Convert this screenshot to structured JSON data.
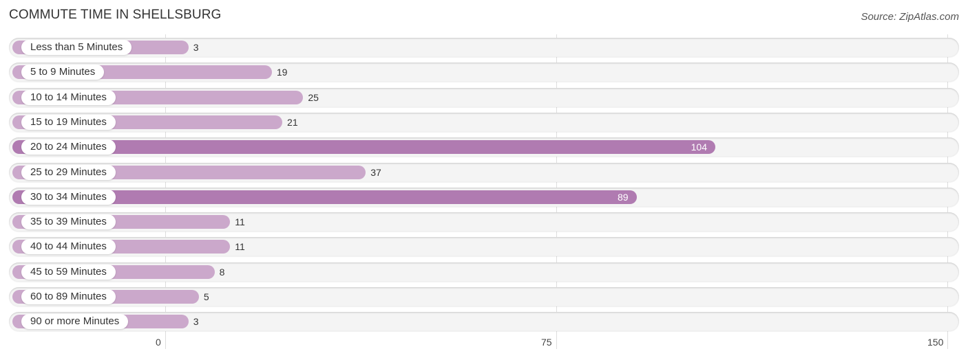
{
  "chart_data": {
    "type": "bar",
    "orientation": "horizontal",
    "title": "COMMUTE TIME IN SHELLSBURG",
    "source": "Source: ZipAtlas.com",
    "categories": [
      "Less than 5 Minutes",
      "5 to 9 Minutes",
      "10 to 14 Minutes",
      "15 to 19 Minutes",
      "20 to 24 Minutes",
      "25 to 29 Minutes",
      "30 to 34 Minutes",
      "35 to 39 Minutes",
      "40 to 44 Minutes",
      "45 to 59 Minutes",
      "60 to 89 Minutes",
      "90 or more Minutes"
    ],
    "values": [
      3,
      19,
      25,
      21,
      104,
      37,
      89,
      11,
      11,
      8,
      5,
      3
    ],
    "xlim": [
      0,
      150
    ],
    "xticks": [
      "0",
      "75",
      "150"
    ],
    "xlabel": "",
    "ylabel": "",
    "grid": true,
    "colors": {
      "bar_light": "#cba8cb",
      "bar_strong": "#b07bb1"
    }
  }
}
